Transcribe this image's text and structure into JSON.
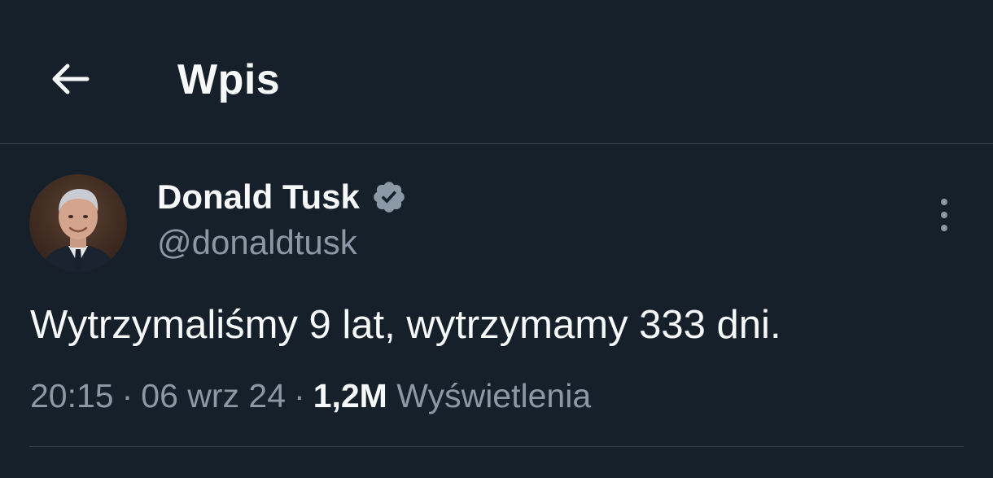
{
  "colors": {
    "background": "#15202b",
    "text_primary": "#f7f9f9",
    "text_secondary": "#8b98a5",
    "divider": "#38444d",
    "verified_badge": "#8b98a5"
  },
  "header": {
    "back_icon": "arrow-left-icon",
    "title": "Wpis"
  },
  "post": {
    "author": {
      "display_name": "Donald Tusk",
      "handle": "@donaldtusk",
      "verified_icon": "verified-badge-icon",
      "avatar": "avatar-photo"
    },
    "more_icon": "more-vertical-icon",
    "text": "Wytrzymaliśmy 9 lat, wytrzymamy 333 dni.",
    "time": "20:15",
    "separator": "·",
    "date": "06 wrz 24",
    "views_count": "1,2M",
    "views_label": "Wyświetlenia"
  }
}
